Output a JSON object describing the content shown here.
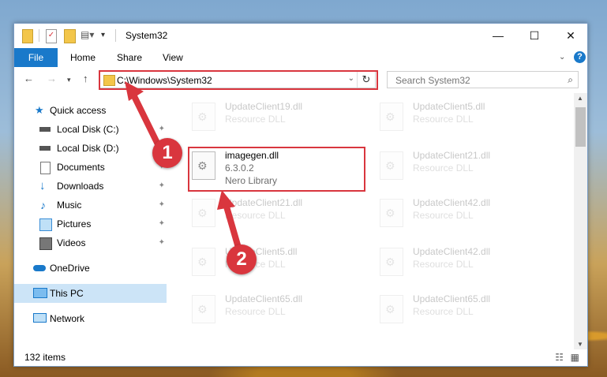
{
  "window": {
    "title": "System32"
  },
  "ribbon": {
    "tabs": [
      "File",
      "Home",
      "Share",
      "View"
    ]
  },
  "address": {
    "path": "C:\\Windows\\System32"
  },
  "search": {
    "placeholder": "Search System32"
  },
  "sidebar": {
    "items": [
      {
        "label": "Quick access",
        "icon": "star-icon",
        "pinned": false
      },
      {
        "label": "Local Disk (C:)",
        "icon": "drive-icon",
        "pinned": true
      },
      {
        "label": "Local Disk (D:)",
        "icon": "drive-icon",
        "pinned": true
      },
      {
        "label": "Documents",
        "icon": "documents-icon",
        "pinned": true
      },
      {
        "label": "Downloads",
        "icon": "download-icon",
        "pinned": true
      },
      {
        "label": "Music",
        "icon": "music-icon",
        "pinned": true
      },
      {
        "label": "Pictures",
        "icon": "pictures-icon",
        "pinned": true
      },
      {
        "label": "Videos",
        "icon": "videos-icon",
        "pinned": true
      },
      {
        "label": "OneDrive",
        "icon": "cloud-icon",
        "pinned": false
      },
      {
        "label": "This PC",
        "icon": "computer-icon",
        "pinned": false,
        "selected": true
      },
      {
        "label": "Network",
        "icon": "network-icon",
        "pinned": false
      }
    ]
  },
  "files": [
    {
      "name": "UpdateClient19.dll",
      "sub": "Resource DLL"
    },
    {
      "name": "UpdateClient5.dll",
      "sub": "Resource DLL"
    },
    {
      "name": "imagegen.dll",
      "version": "6.3.0.2",
      "sub": "Nero Library"
    },
    {
      "name": "UpdateClient21.dll",
      "sub": "Resource DLL"
    },
    {
      "name": "UpdateClient21.dll",
      "sub": "Resource DLL"
    },
    {
      "name": "UpdateClient42.dll",
      "sub": "Resource DLL"
    },
    {
      "name": "UpdateClient5.dll",
      "sub": "Resource DLL"
    },
    {
      "name": "UpdateClient42.dll",
      "sub": "Resource DLL"
    },
    {
      "name": "UpdateClient65.dll",
      "sub": "Resource DLL"
    },
    {
      "name": "UpdateClient65.dll",
      "sub": "Resource DLL"
    }
  ],
  "status": {
    "count": "132 items"
  },
  "callouts": [
    "1",
    "2"
  ],
  "colors": {
    "accent": "#1979ca",
    "highlight": "#d9363e",
    "selected": "#cce4f7"
  }
}
